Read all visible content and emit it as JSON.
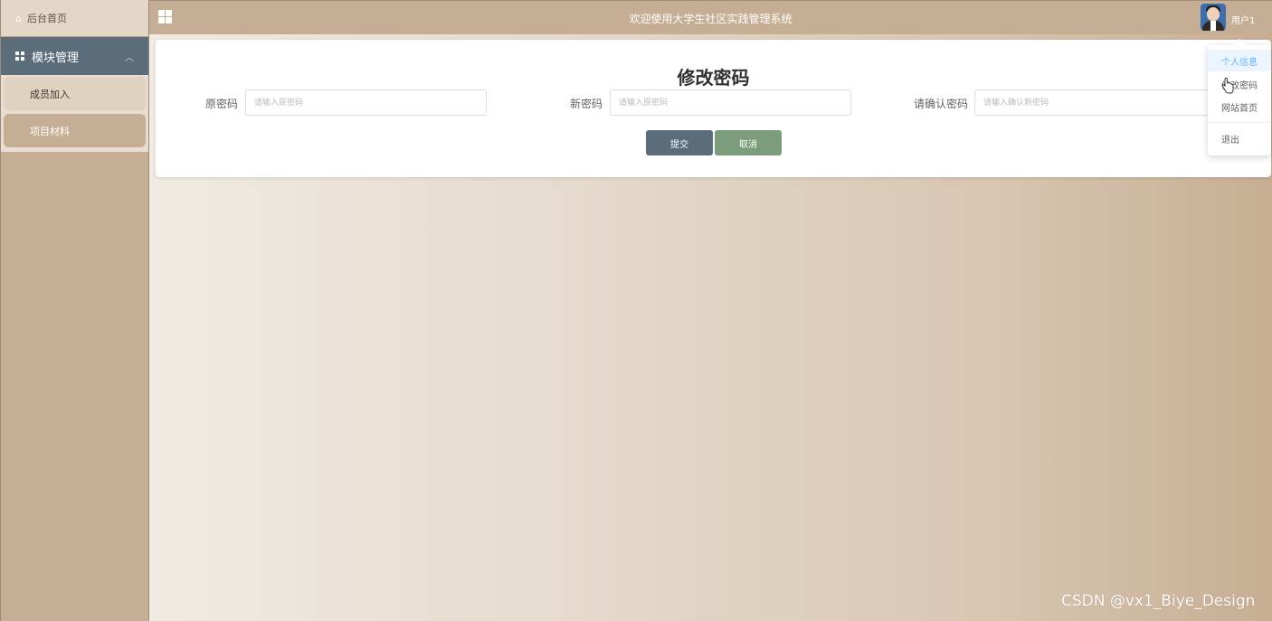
{
  "sidebar": {
    "home_label": "后台首页",
    "group_label": "模块管理",
    "items": [
      {
        "label": "成员加入"
      },
      {
        "label": "项目材料"
      }
    ]
  },
  "header": {
    "title": "欢迎使用大学生社区实践管理系统",
    "username": "用户1"
  },
  "form": {
    "title": "修改密码",
    "fields": [
      {
        "label": "原密码",
        "placeholder": "请输入原密码"
      },
      {
        "label": "新密码",
        "placeholder": "请输入原密码"
      },
      {
        "label": "请确认密码",
        "placeholder": "请输入确认新密码"
      }
    ],
    "submit_label": "提交",
    "cancel_label": "取消"
  },
  "dropdown": {
    "items": [
      {
        "label": "个人信息"
      },
      {
        "label": "修改密码"
      },
      {
        "label": "网站首页"
      },
      {
        "label": "退出"
      }
    ]
  },
  "watermark": "CSDN @vx1_Biye_Design",
  "colors": {
    "sidebar_group_bg": "#5b6d7b",
    "submit_button": "#5b6d7b",
    "cancel_button": "#7c9d7c",
    "header_bg": "#c6ae94",
    "dropdown_active": "#66b1ff"
  },
  "icons": [
    "home-icon",
    "grid-icon",
    "chevron-up-icon",
    "menu-grid-icon",
    "avatar",
    "hand-cursor-icon"
  ]
}
